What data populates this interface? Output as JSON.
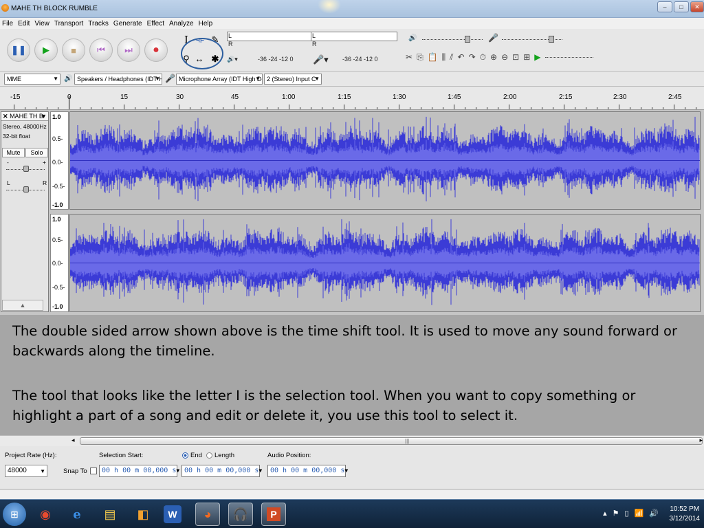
{
  "window": {
    "title": "MAHE TH BLOCK RUMBLE",
    "minimize": "–",
    "maximize": "□",
    "close": "✕"
  },
  "menu": [
    "File",
    "Edit",
    "View",
    "Transport",
    "Tracks",
    "Generate",
    "Effect",
    "Analyze",
    "Help"
  ],
  "transport": {
    "pause": "❚❚",
    "play": "▶",
    "stop": "■",
    "skip_start": "⏮",
    "skip_end": "⏭",
    "record": "●"
  },
  "tools": {
    "selection": "I",
    "envelope": "⟛",
    "draw": "✎",
    "zoom": "⚲",
    "timeshift": "↔",
    "multi": "✱"
  },
  "meters": {
    "play_scale": "-36  -24  -12  0",
    "rec_scale": "-36  -24  -12  0",
    "L": "L",
    "R": "R"
  },
  "device": {
    "host": "MME",
    "output": "Speakers / Headphones (IDT H",
    "input": "Microphone Array (IDT High De",
    "channels": "2 (Stereo) Input C"
  },
  "ruler": {
    "labels": [
      "-15",
      "0",
      "15",
      "30",
      "45",
      "1:00",
      "1:15",
      "1:30",
      "1:45",
      "2:00",
      "2:15",
      "2:30",
      "2:45"
    ]
  },
  "track": {
    "name": "MAHE TH B",
    "format": "Stereo, 48000Hz",
    "bitdepth": "32-bit float",
    "mute": "Mute",
    "solo": "Solo",
    "gain_minus": "-",
    "gain_plus": "+",
    "pan_left": "L",
    "pan_right": "R",
    "collapse": "▲",
    "scale": [
      "1.0",
      "0.5-",
      "0.0-",
      "-0.5-",
      "-1.0"
    ]
  },
  "caption": {
    "para1": "The double sided arrow shown above is the time shift tool.  It is used to move any sound forward or backwards along the timeline.",
    "para2": "The tool that looks like the letter I is the selection tool.  When you want to copy something or highlight a part of a song and edit or delete it, you use this tool to select it."
  },
  "selection_bar": {
    "project_rate_label": "Project Rate (Hz):",
    "project_rate": "48000",
    "snap_to": "Snap To",
    "selection_start_label": "Selection Start:",
    "end_label": "End",
    "length_label": "Length",
    "audio_position_label": "Audio Position:",
    "start_time": "00 h 00 m 00,000 s",
    "end_time": "00 h 00 m 00,000 s",
    "audio_time": "00 h 00 m 00,000 s"
  },
  "taskbar": {
    "time": "10:52 PM",
    "date": "3/12/2014"
  },
  "colors": {
    "waveform": "#3b3bd6",
    "waveform_rms": "#6a6ae8",
    "highlight_circle": "#2e5fa0"
  }
}
